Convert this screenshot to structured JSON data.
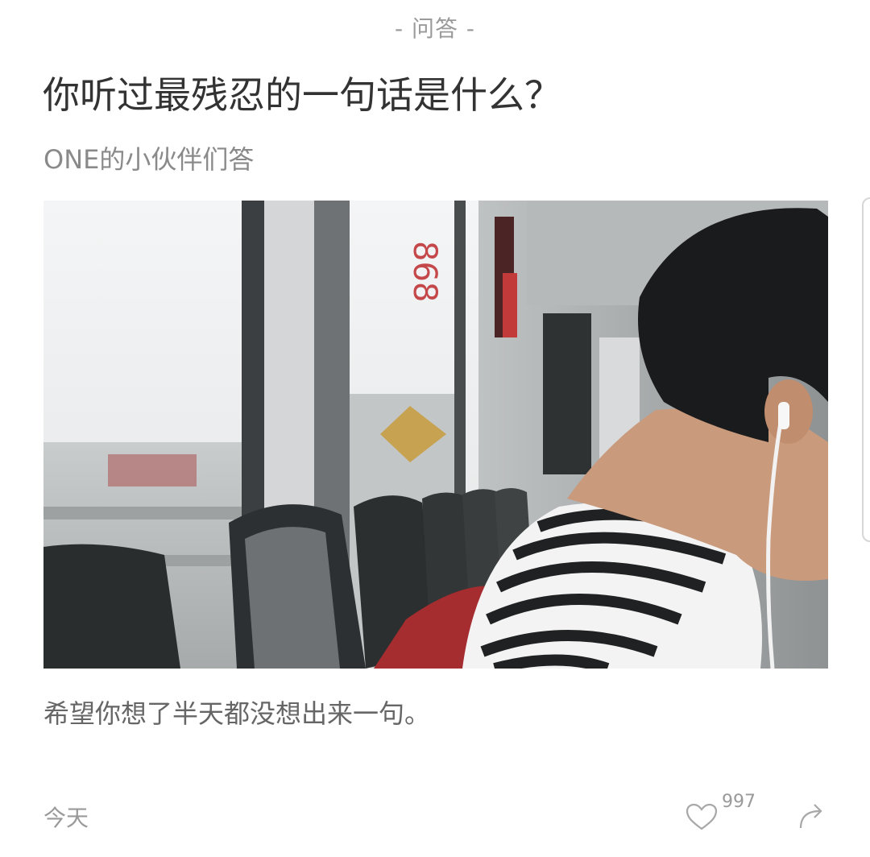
{
  "header": {
    "category": "- 问答 -"
  },
  "article": {
    "title": "你听过最残忍的一句话是什么？",
    "author": "ONE的小伙伴们答",
    "image_description_icon": "photo",
    "answer": "希望你想了半天都没想出来一句。"
  },
  "footer": {
    "date": "今天",
    "like_icon": "heart-icon",
    "like_count": "997",
    "share_icon": "share-arrow-icon"
  },
  "colors": {
    "title": "#333333",
    "muted": "#9a9a9a",
    "body": "#666666"
  }
}
